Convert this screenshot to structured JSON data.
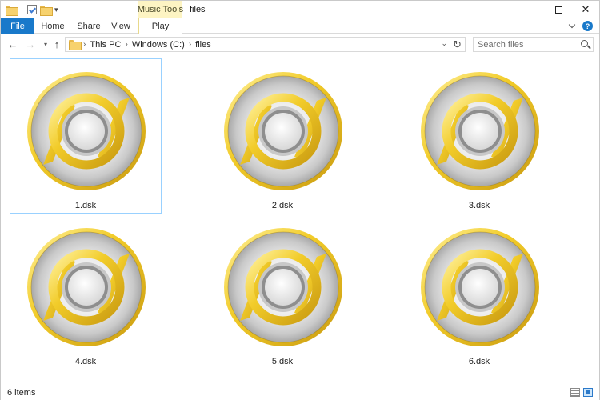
{
  "window": {
    "title": "files",
    "contextual_tab": "Music Tools"
  },
  "ribbon": {
    "tabs": [
      {
        "label": "File"
      },
      {
        "label": "Home"
      },
      {
        "label": "Share"
      },
      {
        "label": "View"
      },
      {
        "label": "Play"
      }
    ]
  },
  "address": {
    "crumbs": [
      "This PC",
      "Windows (C:)",
      "files"
    ]
  },
  "search": {
    "placeholder": "Search files"
  },
  "files": [
    {
      "name": "1.dsk",
      "icon": "disc-icon",
      "selected": true
    },
    {
      "name": "2.dsk",
      "icon": "disc-icon",
      "selected": false
    },
    {
      "name": "3.dsk",
      "icon": "disc-icon",
      "selected": false
    },
    {
      "name": "4.dsk",
      "icon": "disc-icon",
      "selected": false
    },
    {
      "name": "5.dsk",
      "icon": "disc-icon",
      "selected": false
    },
    {
      "name": "6.dsk",
      "icon": "disc-icon",
      "selected": false
    }
  ],
  "status": {
    "item_count": "6 items"
  },
  "colors": {
    "file_tab": "#1979ca",
    "music_tools": "#fdf4c3",
    "selection_border": "#99d1ff",
    "disc_gold": "#f2cc2a"
  }
}
